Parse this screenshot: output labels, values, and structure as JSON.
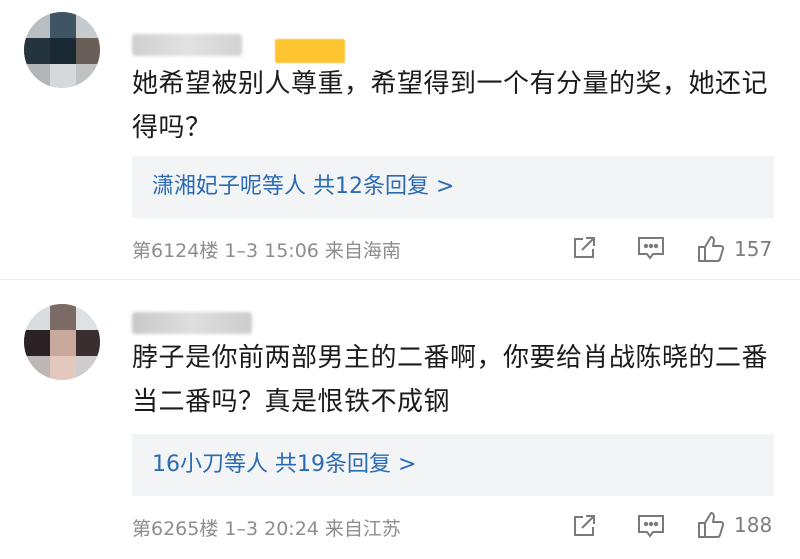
{
  "comments": [
    {
      "text": "她希望被别人尊重，希望得到一个有分量的奖，她还记得吗？",
      "reply_summary": "潇湘妃子呢等人  共12条回复 >",
      "meta": "第6124楼 1–3 15:06  来自海南",
      "like_count": "157",
      "icons": {
        "share": "share-icon",
        "reply": "comment-icon",
        "like": "thumbs-up-icon"
      }
    },
    {
      "text": "脖子是你前两部男主的二番啊，你要给肖战陈晓的二番当二番吗？真是恨铁不成钢",
      "reply_summary": "16小刀等人  共19条回复 >",
      "meta": "第6265楼 1–3 20:24  来自江苏",
      "like_count": "188",
      "icons": {
        "share": "share-icon",
        "reply": "comment-icon",
        "like": "thumbs-up-icon"
      }
    }
  ],
  "colors": {
    "link": "#2a6bb4",
    "meta": "#8d8d8d",
    "reply_bg": "#f3f4f6",
    "badge": "#ffc531"
  }
}
